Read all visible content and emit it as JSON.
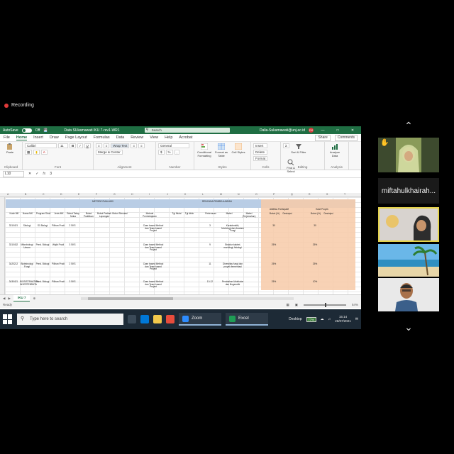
{
  "recording": {
    "label": "Recording"
  },
  "excel": {
    "titlebar": {
      "autosave_label": "AutoSave",
      "autosave_state": "Off",
      "file_name": "Data SUkamawati  IKU 7-rev1-WR1",
      "search_placeholder": "Search",
      "user_email": "Dalia-Sukamawati@unj.ac.id",
      "avatar_initials": "DS"
    },
    "menu": {
      "items": [
        "File",
        "Home",
        "Insert",
        "Draw",
        "Page Layout",
        "Formulas",
        "Data",
        "Review",
        "View",
        "Help",
        "Acrobat"
      ],
      "share_label": "Share",
      "comments_label": "Comments"
    },
    "ribbon": {
      "clipboard": {
        "paste": "Paste",
        "label": "Clipboard"
      },
      "font": {
        "name": "Calibri",
        "size": "11",
        "label": "Font"
      },
      "alignment": {
        "wrap": "Wrap Text",
        "merge": "Merge & Center",
        "label": "Alignment"
      },
      "number": {
        "format": "General",
        "label": "Number"
      },
      "styles": {
        "conditional": "Conditional Formatting",
        "format_table": "Format as Table",
        "cell_styles": "Cell Styles",
        "label": "Styles"
      },
      "cells": {
        "insert": "Insert",
        "delete": "Delete",
        "format": "Format",
        "label": "Cells"
      },
      "editing": {
        "sort": "Sort & Filter",
        "find": "Find & Select",
        "label": "Editing"
      },
      "analysis": {
        "analyze": "Analyze Data",
        "label": "Analysis"
      }
    },
    "formula_bar": {
      "cell_ref": "L10",
      "fx": "fx",
      "value": "3"
    },
    "columns": [
      "A",
      "B",
      "C",
      "D",
      "E",
      "F",
      "G",
      "H",
      "I",
      "J",
      "K",
      "L",
      "M",
      "N",
      "O",
      "P",
      "Q",
      "R",
      "S",
      "T"
    ],
    "table": {
      "band_left": "METODE EVALUASI",
      "band_mid": "RENCANA PEMBELAJARAN",
      "header_a": "Aktifitas Partisipatif",
      "header_b": "Hasil Proyek",
      "columns": [
        "Kode MK",
        "Nama MK",
        "Program Studi",
        "Jenis MK",
        "Bobot Tatap Muka",
        "Bobot Praktikum",
        "Bobot Praktek Lapangan",
        "Bobot Simulasi",
        "Metode Pembelajaran",
        "Tgl Mulai",
        "Tgl Akhir",
        "Pertemuan",
        "Materi",
        "Materi (Terjemahan)",
        "Bobot (%)",
        "Deskripsi",
        "Bobot (%)",
        "Deskripsi"
      ],
      "rows": [
        {
          "kode": "3310421",
          "nama": "Sitologi",
          "prodi": "S1 Biologi",
          "jenis": "Pilihan Prodi",
          "sks": "2 SKS",
          "metode": "Case based Method dan Team based Project",
          "pertemuan": "3",
          "materi": "Karakteristik, Morfologi dan Anatomi Fungi",
          "aktif": "30",
          "hasil": "30"
        },
        {
          "kode": "3310432",
          "nama": "Mikrobiologi Umum",
          "prodi": "Pend. Biologi",
          "jenis": "Wajib Prodi",
          "sks": "3 SKS",
          "metode": "Case based Method dan Team based Project",
          "pertemuan": "9",
          "materi": "Struktur bakteri, morfologi, fisiologi",
          "aktif": "25%",
          "hasil": "25%"
        },
        {
          "kode": "3420212",
          "nama": "Bioteknologi Fungi",
          "prodi": "Pend. Biologi",
          "jenis": "Pilihan Prodi",
          "sks": "2 SKS",
          "metode": "Case based Method dan Team based Project",
          "pertemuan": "11",
          "materi": "Diversitas fungi dan proyek fermentasi",
          "aktif": "25%",
          "hasil": "25%"
        },
        {
          "kode": "3430421",
          "nama": "BIOSISTEMATIKA INVERTEBRATA",
          "prodi": "Pend. Biologi",
          "jenis": "Pilihan Prodi",
          "sks": "3 SKS",
          "metode": "Case based Method dan Team based Project",
          "pertemuan": "10-12",
          "materi": "Perubahan Molekular dan filogenetik",
          "aktif": "25%",
          "hasil": "10%"
        }
      ]
    },
    "sheet_tab": "IKU 7",
    "status": {
      "ready": "Ready",
      "zoom": "54%"
    }
  },
  "taskbar": {
    "search_placeholder": "Type here to search",
    "apps": [
      {
        "name": "Zoom",
        "color": "#2d8cff"
      },
      {
        "name": "Excel",
        "color": "#1f9d55"
      }
    ],
    "tray": {
      "desktop": "Desktop",
      "battery": "77%",
      "time": "15:14",
      "date": "26/07/2021"
    }
  },
  "participants": {
    "hand_icon": "raised-hand",
    "name_tile": "miftahulkhairah..."
  },
  "colors": {
    "excel_green": "#1f6e43",
    "header_blue": "#b9cde5",
    "highlight_orange": "#f7caa8",
    "taskbar": "#1d2a36"
  }
}
